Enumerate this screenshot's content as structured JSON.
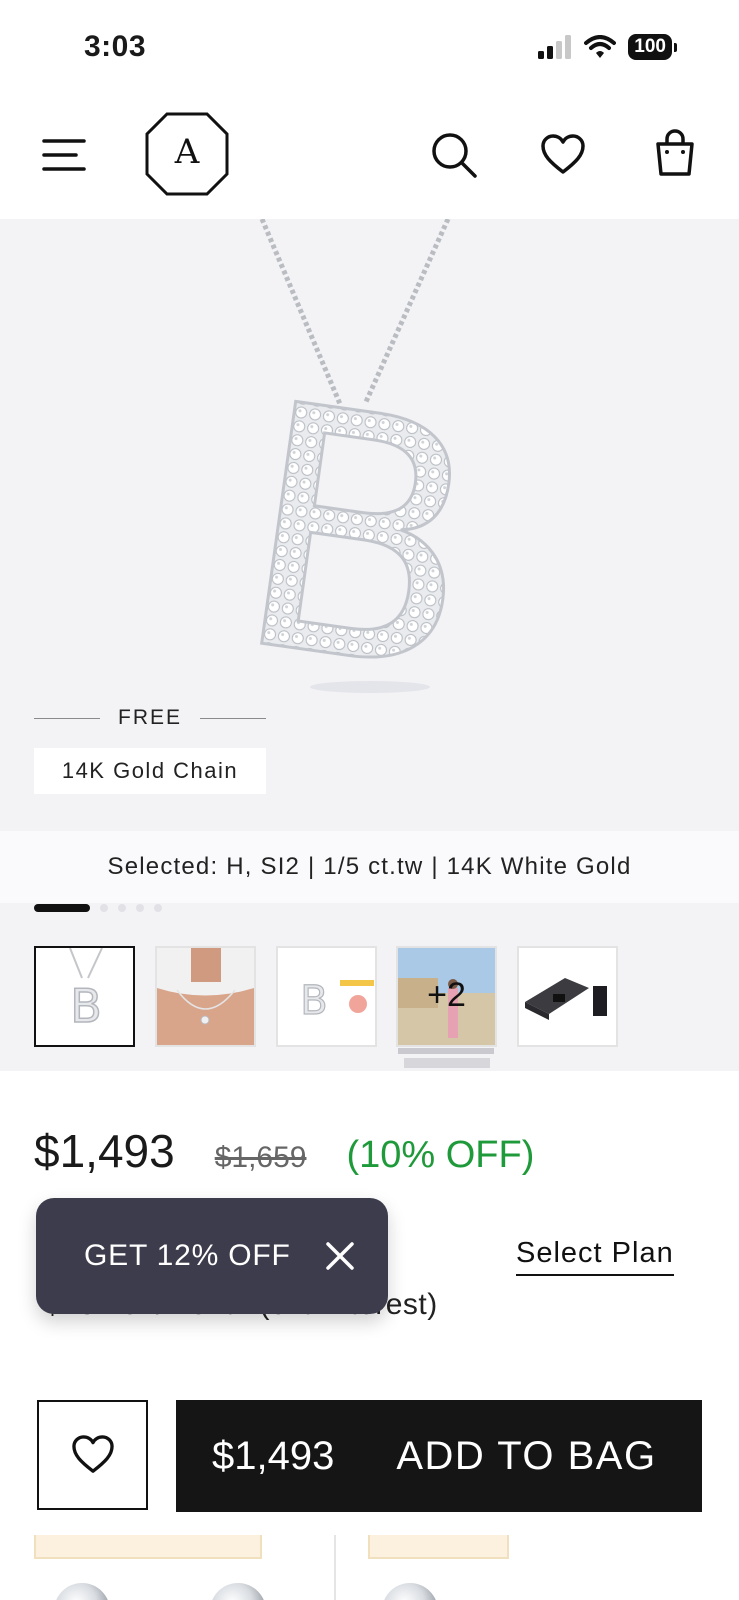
{
  "status_bar": {
    "time": "3:03",
    "battery": "100"
  },
  "header": {
    "logo_letter": "A",
    "icons": [
      "menu-icon",
      "search-icon",
      "heart-icon",
      "shopping-bag-icon"
    ]
  },
  "hero": {
    "pendant_letter": "B",
    "free_label": "FREE",
    "chain_label": "14K Gold Chain"
  },
  "selection": {
    "text": "Selected: H, SI2 | 1/5 ct.tw | 14K White Gold"
  },
  "gallery": {
    "active_index": 0,
    "total_dots": 6,
    "thumbnails": [
      {
        "name": "pendant-front"
      },
      {
        "name": "model-wearing"
      },
      {
        "name": "size-comparison",
        "letter": "B"
      },
      {
        "name": "customer-photo",
        "overlay": "+2"
      },
      {
        "name": "packaging-box"
      }
    ]
  },
  "pricing": {
    "price": "$1,493",
    "original_price": "$1,659",
    "discount": "(10% OFF)",
    "installment_text": "$137.07/month (0% Interest)",
    "select_plan_label": "Select Plan"
  },
  "promo": {
    "label": "GET 12% OFF"
  },
  "actions": {
    "bag_price": "$1,493",
    "add_to_bag_label": "ADD TO BAG"
  },
  "colors": {
    "accent_green": "#1f9a3a",
    "promo_bg": "#3d3c4c",
    "button_bg": "#151515"
  }
}
